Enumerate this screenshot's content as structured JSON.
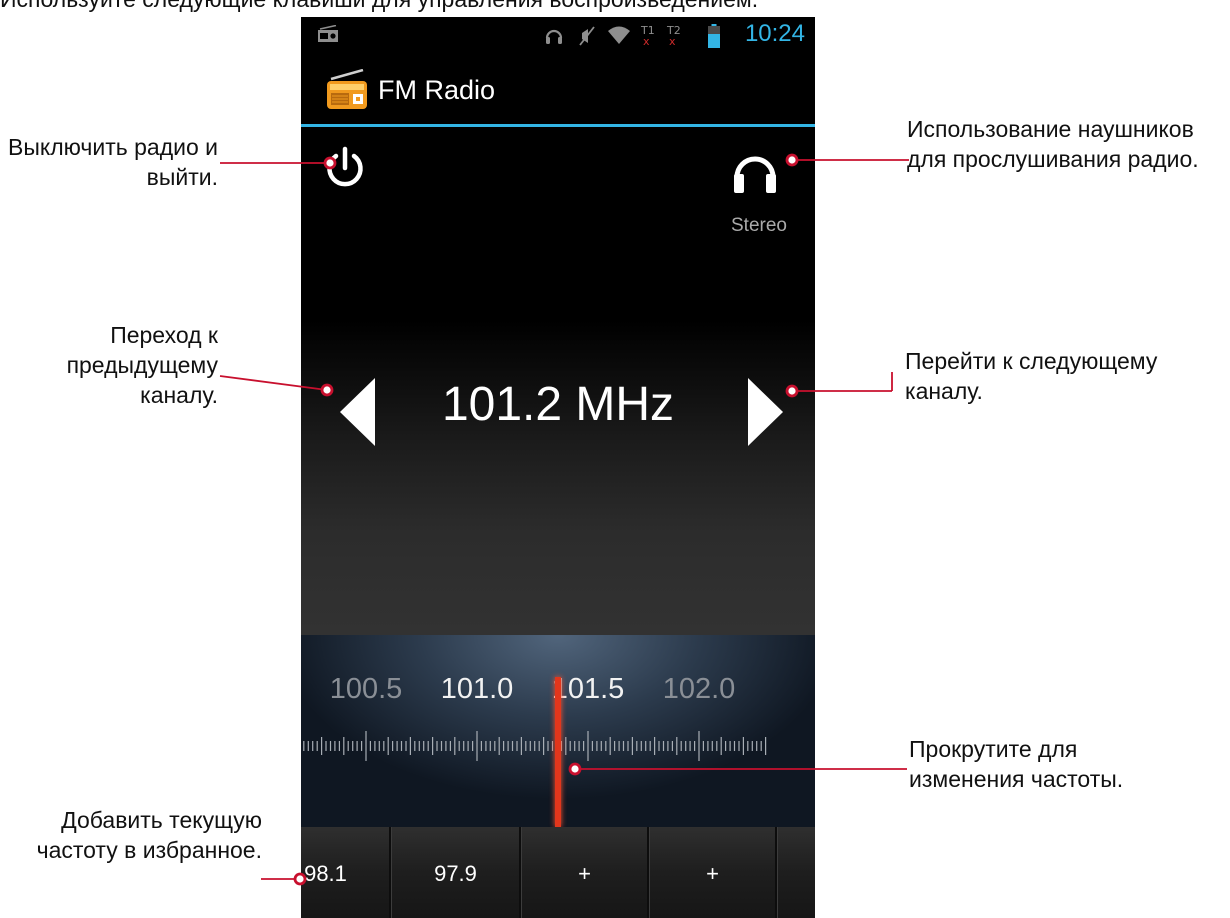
{
  "intro_text": "Используйте следующие клавиши для управления воспроизведением.",
  "status_bar": {
    "time": "10:24",
    "icons": [
      "radio-icon",
      "headset-icon",
      "vibrate-icon",
      "wifi-icon",
      "sim1-icon",
      "sim2-icon",
      "battery-icon"
    ]
  },
  "app": {
    "title": "FM Radio",
    "icon": "radio-icon"
  },
  "controls": {
    "power_icon": "power-icon",
    "headphones_icon": "headphones-icon",
    "audio_mode": "Stereo",
    "prev_icon": "triangle-left-icon",
    "next_icon": "triangle-right-icon",
    "frequency": "101.2 MHz"
  },
  "tuner": {
    "labels": [
      "100.5",
      "101.0",
      "101.5",
      "102.0"
    ],
    "current": 101.2
  },
  "favorites": [
    "98.1",
    "97.9",
    "+",
    "+",
    ""
  ],
  "annotations": {
    "power": "Выключить радио и выйти.",
    "headphones": "Использование наушников для прослушивания радио.",
    "prev": "Переход к предыдущему каналу.",
    "next": "Перейти к следующему каналу.",
    "scroll": "Прокрутите для изменения частоты.",
    "favorite": "Добавить текущую частоту в избранное."
  },
  "colors": {
    "accent": "#33b5e5",
    "needle": "#e2361c",
    "callout": "#c8102e"
  }
}
